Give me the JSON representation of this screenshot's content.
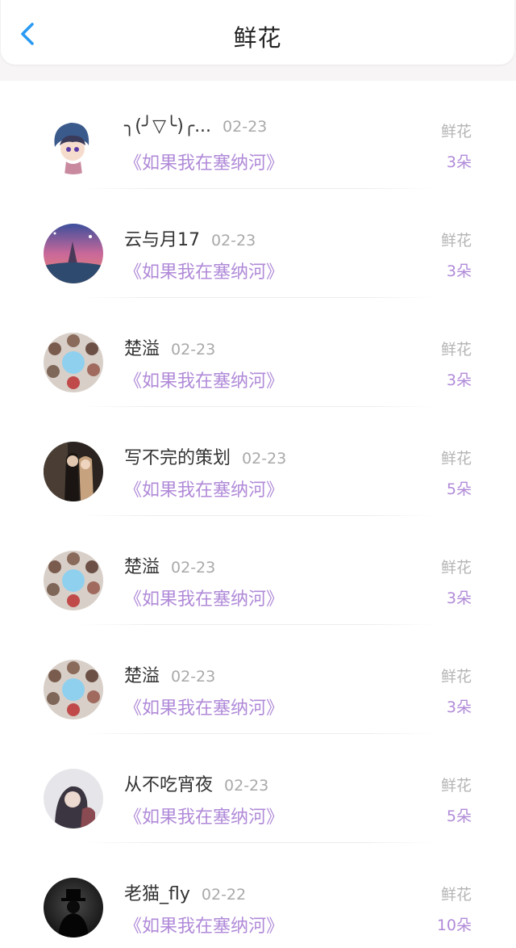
{
  "header": {
    "title": "鲜花"
  },
  "list": [
    {
      "name": "╮(╯▽╰)╭...",
      "date": "02-23",
      "book": "《如果我在塞纳河》",
      "gift_label": "鲜花",
      "count": "3朵"
    },
    {
      "name": "云与月17",
      "date": "02-23",
      "book": "《如果我在塞纳河》",
      "gift_label": "鲜花",
      "count": "3朵"
    },
    {
      "name": "楚溢",
      "date": "02-23",
      "book": "《如果我在塞纳河》",
      "gift_label": "鲜花",
      "count": "3朵"
    },
    {
      "name": "写不完的策划",
      "date": "02-23",
      "book": "《如果我在塞纳河》",
      "gift_label": "鲜花",
      "count": "5朵"
    },
    {
      "name": "楚溢",
      "date": "02-23",
      "book": "《如果我在塞纳河》",
      "gift_label": "鲜花",
      "count": "3朵"
    },
    {
      "name": "楚溢",
      "date": "02-23",
      "book": "《如果我在塞纳河》",
      "gift_label": "鲜花",
      "count": "3朵"
    },
    {
      "name": "从不吃宵夜",
      "date": "02-23",
      "book": "《如果我在塞纳河》",
      "gift_label": "鲜花",
      "count": "5朵"
    },
    {
      "name": "老猫_fly",
      "date": "02-22",
      "book": "《如果我在塞纳河》",
      "gift_label": "鲜花",
      "count": "10朵"
    }
  ],
  "colors": {
    "accent_back": "#2a9af3",
    "book_purple": "#b08ad8",
    "muted_gray": "#a9a9a9"
  }
}
